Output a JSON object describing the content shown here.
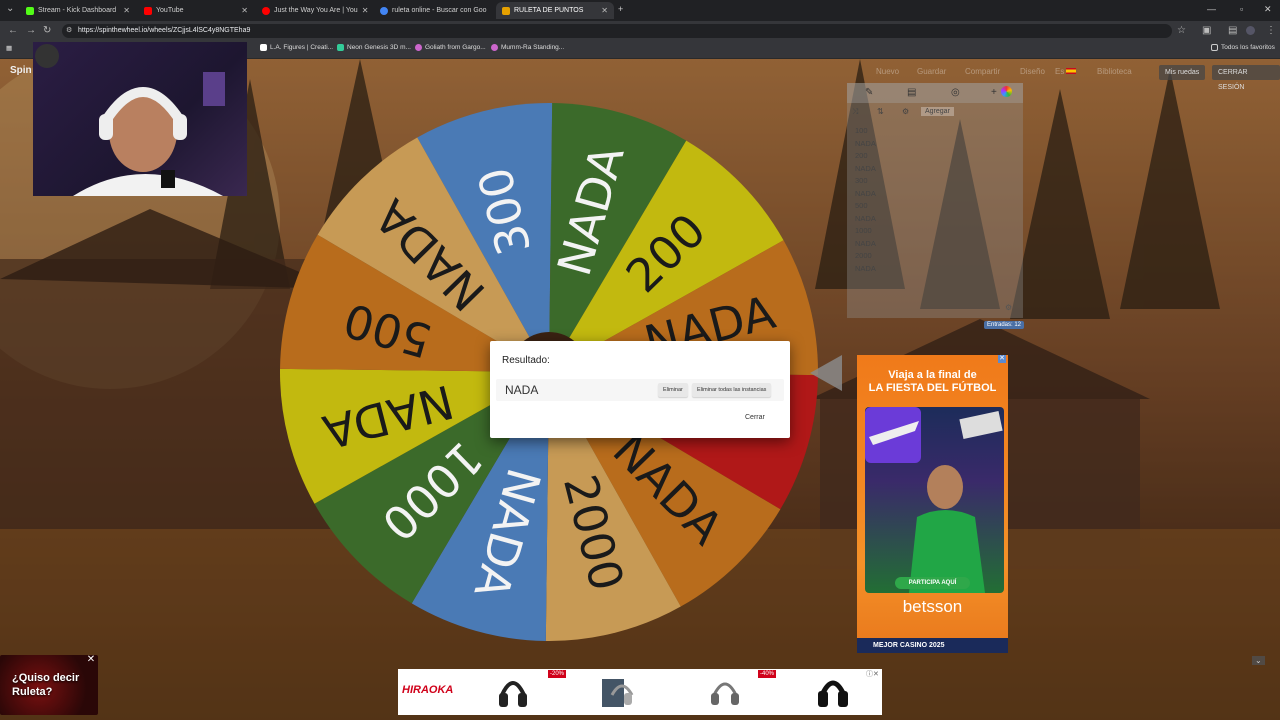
{
  "browser": {
    "tabs": [
      {
        "title": "Stream - Kick Dashboard",
        "favicon": "kick-icon",
        "color": "#53fc18"
      },
      {
        "title": "YouTube",
        "favicon": "youtube-icon",
        "color": "#ff0000"
      },
      {
        "title": "Just the Way You Are | You",
        "favicon": "youtube-icon",
        "color": "#ff0000"
      },
      {
        "title": "ruleta online - Buscar con Goo",
        "favicon": "google-icon",
        "color": "#4285f4"
      },
      {
        "title": "RULETA DE PUNTOS",
        "favicon": "wheel-icon",
        "color": "#e6a100"
      }
    ],
    "url": "https://spinthewheel.io/wheels/ZCjjsL4lSC4y8NGTEha9",
    "bookmarks": [
      {
        "label": "L.A. Figures | Creati...",
        "color": "#ffffff"
      },
      {
        "label": "Neon Genesis 3D m...",
        "color": "#3c9"
      },
      {
        "label": "Goliath from Gargo...",
        "color": "#c6c"
      },
      {
        "label": "Mumm-Ra Standing...",
        "color": "#c6c"
      }
    ],
    "all_bookmarks": "Todos los favoritos"
  },
  "site": {
    "logo": "Spin",
    "nav": [
      "Nuevo",
      "Guardar",
      "Compartir",
      "Diseño",
      "Es",
      "Biblioteca"
    ],
    "my_wheels": "Mis ruedas",
    "logout": "CERRAR SESIÓN"
  },
  "panel": {
    "add_label": "Agregar",
    "entries": [
      "100",
      "NADA",
      "200",
      "NADA",
      "300",
      "NADA",
      "500",
      "NADA",
      "1000",
      "NADA",
      "2000",
      "NADA"
    ],
    "entry_count": "Entradas: 12"
  },
  "wheel": {
    "segments": [
      {
        "label": "300",
        "color": "#4a7ab5"
      },
      {
        "label": "NADA",
        "color": "#3b6a2a"
      },
      {
        "label": "200",
        "color": "#c2b90f"
      },
      {
        "label": "NADA",
        "color": "#b86c1c"
      },
      {
        "label": "500",
        "color": "#b01818"
      },
      {
        "label": "NADA",
        "color": "#b86c1c"
      },
      {
        "label": "2000",
        "color": "#c79a55"
      },
      {
        "label": "NADA",
        "color": "#4a7ab5"
      },
      {
        "label": "1000",
        "color": "#3b6a2a"
      },
      {
        "label": "NADA",
        "color": "#c2b90f"
      },
      {
        "label": "500",
        "color": "#b86c1c"
      },
      {
        "label": "NADA",
        "color": "#c79a55"
      }
    ]
  },
  "dialog": {
    "title": "Resultado:",
    "result": "NADA",
    "remove_label": "Eliminar",
    "remove_all_label": "Eliminar todas las instancias",
    "close_label": "Cerrar"
  },
  "ads": {
    "right": {
      "headline1": "Viaja a la final de",
      "headline2": "LA FIESTA DEL FÚTBOL",
      "cta": "PARTICIPA AQUÍ",
      "brand": "betsson",
      "footer": "MEJOR CASINO 2025"
    },
    "bottom": {
      "brand": "HIRAOKA",
      "discounts": [
        "-20%",
        "-40%"
      ]
    },
    "left": {
      "text1": "¿Quiso decir",
      "text2": "Ruleta?"
    }
  }
}
